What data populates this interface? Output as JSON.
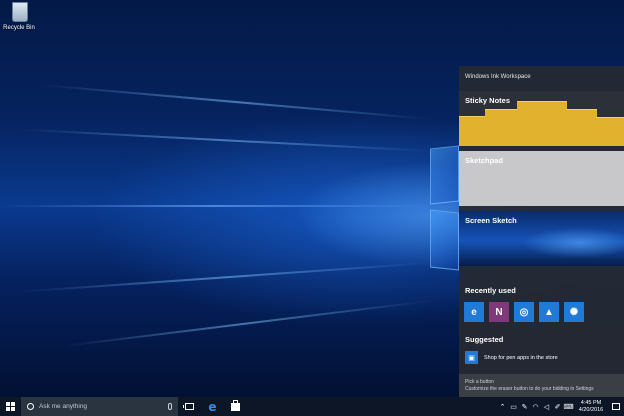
{
  "desktop": {
    "icons": [
      {
        "label": "Recycle Bin",
        "icon": "recycle-bin-icon"
      }
    ]
  },
  "ink_workspace": {
    "title": "Windows Ink Workspace",
    "sticky_notes": {
      "label": "Sticky Notes"
    },
    "sketchpad": {
      "label": "Sketchpad"
    },
    "screen_sketch": {
      "label": "Screen Sketch"
    },
    "recently_used": {
      "label": "Recently used",
      "apps": [
        {
          "icon": "edge-icon",
          "glyph": "e",
          "color": "#1f7ad8"
        },
        {
          "icon": "onenote-icon",
          "glyph": "N",
          "color": "#80397b"
        },
        {
          "icon": "maps-icon",
          "glyph": "◎",
          "color": "#1f7ad8"
        },
        {
          "icon": "photos-icon",
          "glyph": "▲",
          "color": "#1f7ad8"
        },
        {
          "icon": "tips-icon",
          "glyph": "✺",
          "color": "#1f7ad8"
        }
      ]
    },
    "suggested": {
      "label": "Suggested",
      "store_link": "Shop for pen apps in the store"
    },
    "footer": {
      "line1": "Pick a button",
      "line2": "Customize the eraser button to do your bidding in Settings"
    }
  },
  "taskbar": {
    "search_placeholder": "Ask me anything",
    "pinned": [
      "task-view-icon",
      "edge-icon",
      "store-icon"
    ],
    "tray_icons": [
      "chevron-up-icon",
      "network-icon",
      "pen-workspace-icon",
      "wifi-icon",
      "volume-icon",
      "pen-icon",
      "keyboard-icon"
    ],
    "clock": {
      "time": "4:45 PM",
      "date": "4/20/2016"
    }
  },
  "colors": {
    "panel": "#262a32",
    "sticky": "#e0b22e",
    "sketchpad": "#c8c7c9",
    "accent": "#1f7ad8",
    "taskbar": "#0c1626"
  }
}
